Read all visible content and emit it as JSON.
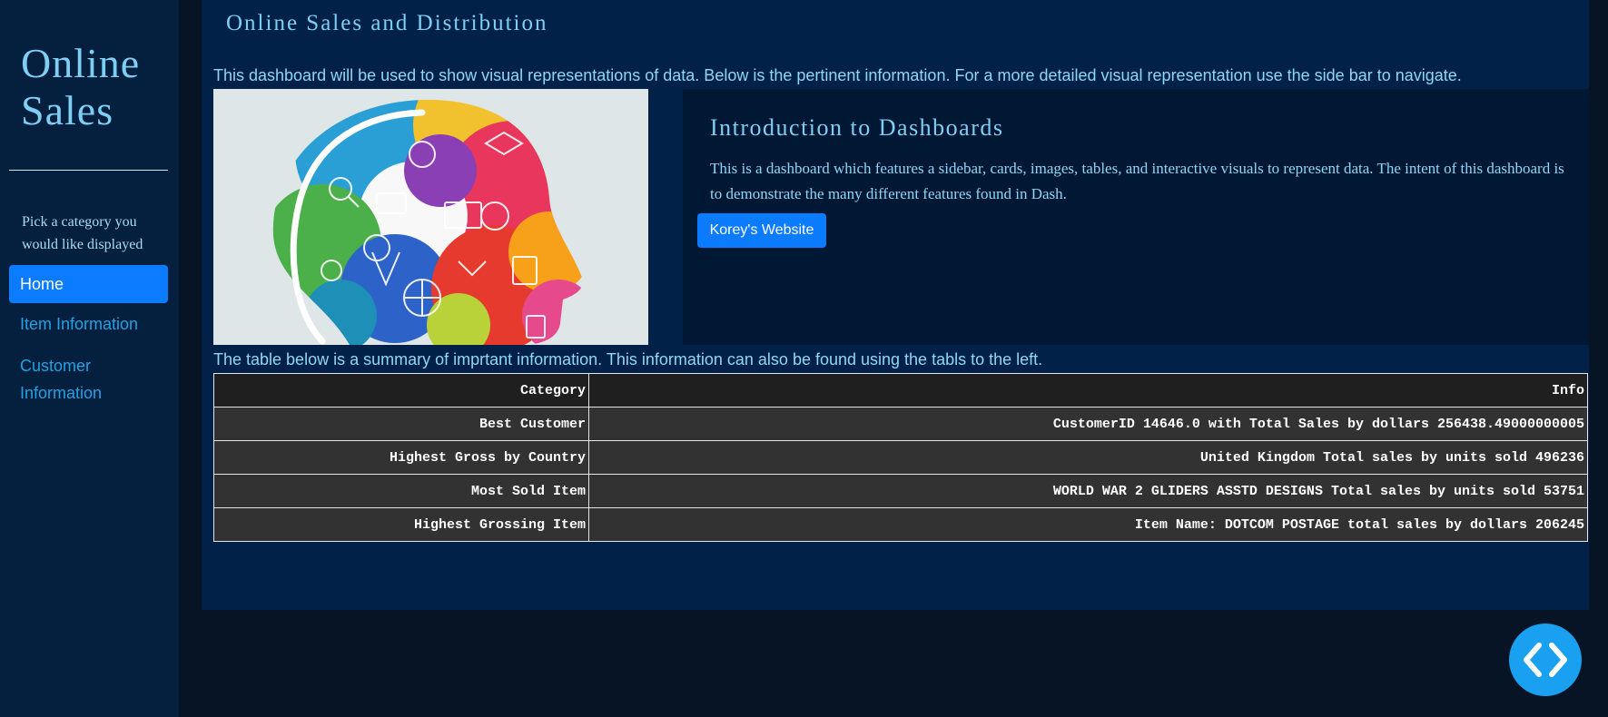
{
  "sidebar": {
    "brand": "Online Sales",
    "prompt": "Pick a category you would like displayed",
    "nav": [
      {
        "label": "Home",
        "active": true
      },
      {
        "label": "Item Information",
        "active": false
      },
      {
        "label": "Customer Information",
        "active": false
      }
    ]
  },
  "main": {
    "title": "Online Sales and Distribution",
    "intro": "This dashboard will be used to show visual representations of data. Below is the pertinent information. For a more detailed visual representation use the side bar to navigate.",
    "card": {
      "title": "Introduction to Dashboards",
      "text": "This is a dashboard which features a sidebar, cards, images, tables, and interactive visuals to represent data. The intent of this dashboard is to demonstrate the many different features found in Dash.",
      "button_label": "Korey's Website"
    },
    "table_caption": "The table below is a summary of imprtant information. This information can also be found using the tabls to the left.",
    "table": {
      "headers": [
        "Category",
        "Info"
      ],
      "rows": [
        [
          "Best Customer",
          "CustomerID 14646.0 with Total Sales by dollars 256438.49000000005"
        ],
        [
          "Highest Gross by Country",
          "United Kingdom Total sales by units sold 496236"
        ],
        [
          "Most Sold Item",
          "WORLD WAR 2 GLIDERS ASSTD DESIGNS Total sales by units sold 53751"
        ],
        [
          "Highest Grossing Item",
          "Item Name: DOTCOM POSTAGE total sales by dollars 206245"
        ]
      ]
    }
  },
  "fab": {
    "icon": "code-icon"
  },
  "colors": {
    "sidebar_bg": "#051f3f",
    "main_bg": "#012148",
    "card_bg": "#011834",
    "page_bg": "#071426",
    "accent": "#0b7bff",
    "title_text": "#7fcff5",
    "body_text": "#8fd6f7",
    "link_text": "#21a3e6",
    "fab": "#1aa0f0"
  }
}
